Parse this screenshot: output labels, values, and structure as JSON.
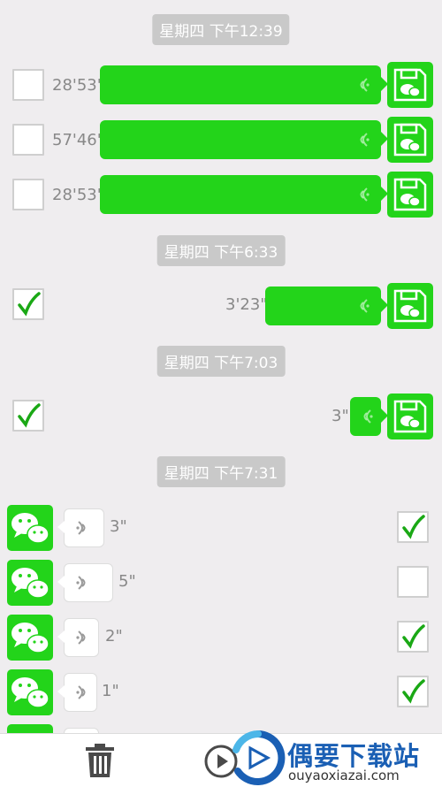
{
  "groups": [
    {
      "timestamp": "星期四 下午12:39"
    },
    {
      "timestamp": "星期四 下午6:33"
    },
    {
      "timestamp": "星期四 下午7:03"
    },
    {
      "timestamp": "星期四 下午7:31"
    }
  ],
  "sent_messages": [
    {
      "duration": "28'53\"",
      "checked": false
    },
    {
      "duration": "57'46\"",
      "checked": false
    },
    {
      "duration": "28'53\"",
      "checked": false
    },
    {
      "duration": "3'23\"",
      "checked": true
    },
    {
      "duration": "3\"",
      "checked": true
    }
  ],
  "received_messages": [
    {
      "duration": "3\"",
      "checked": true
    },
    {
      "duration": "5\"",
      "checked": false
    },
    {
      "duration": "2\"",
      "checked": true
    },
    {
      "duration": "1\"",
      "checked": true
    }
  ],
  "toolbar": {
    "delete_icon": "trash-icon",
    "play_icon": "play-icon"
  },
  "watermark": {
    "name": "偶要下载站",
    "url": "ouyaoxiazai.com"
  },
  "colors": {
    "accent_green": "#23d41a",
    "background": "#efedef",
    "timestamp_bg": "#c9c9c9",
    "watermark_blue": "#1a5fb4"
  }
}
